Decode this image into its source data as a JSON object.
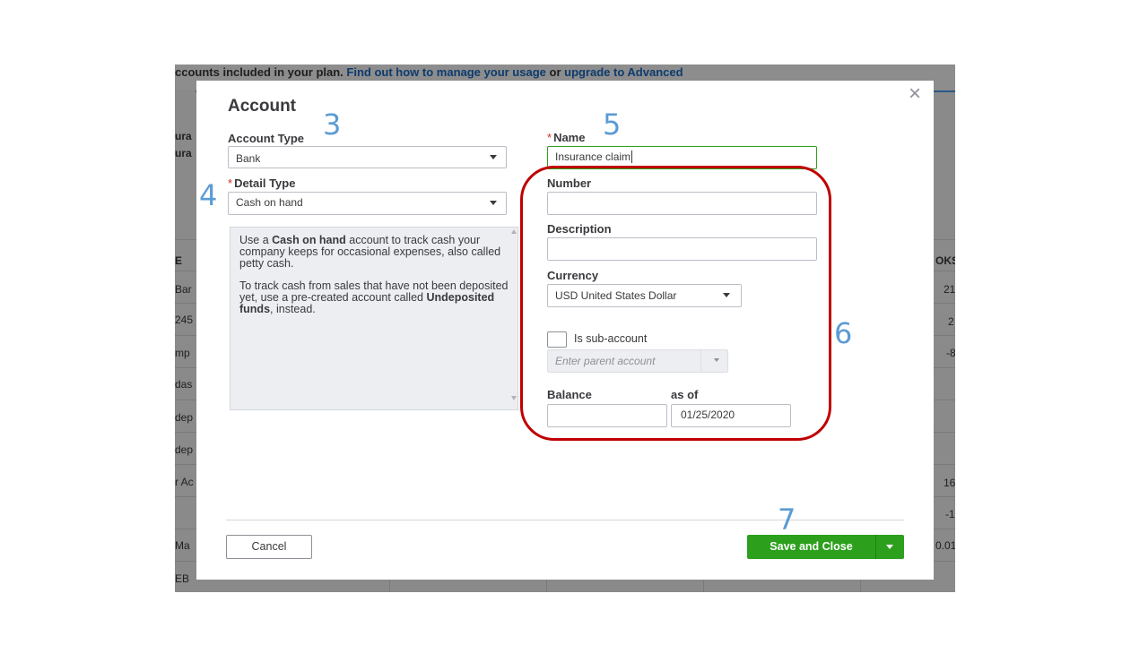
{
  "background": {
    "banner_text": "ccounts included in your plan. ",
    "banner_link_manage": "Find out how to manage your usage",
    "banner_or": " or ",
    "banner_link_upgrade": "upgrade to Advanced",
    "side_texts": [
      "ura",
      "ura",
      "E",
      "Bar",
      "245",
      "mp",
      "das",
      "dep",
      "dep",
      "r Ac",
      "Ma",
      "EB"
    ],
    "right_texts": [
      "OKS",
      "21",
      "2",
      "-8",
      "16",
      "-1",
      "0.01"
    ]
  },
  "modal": {
    "title": "Account",
    "close_label": "×",
    "account_type": {
      "label": "Account Type",
      "value": "Bank"
    },
    "detail_type": {
      "label": "Detail Type",
      "required_mark": "*",
      "value": "Cash on hand"
    },
    "description_panel": {
      "p1_pre": "Use a ",
      "p1_bold": "Cash on hand",
      "p1_post": " account to track cash your company keeps for occasional expenses, also called petty cash.",
      "p2_pre": "To track cash from sales that have not been deposited yet, use a pre-created account called ",
      "p2_bold": "Undeposited funds",
      "p2_post": ", instead."
    },
    "name": {
      "label": "Name",
      "required_mark": "*",
      "value": "Insurance claim"
    },
    "number": {
      "label": "Number",
      "value": ""
    },
    "description": {
      "label": "Description",
      "value": ""
    },
    "currency": {
      "label": "Currency",
      "value": "USD United States Dollar"
    },
    "sub_account": {
      "label": "Is sub-account",
      "checked": false
    },
    "parent_account": {
      "placeholder": "Enter parent account"
    },
    "balance": {
      "label": "Balance",
      "value": ""
    },
    "as_of": {
      "label": "as of",
      "value": "01/25/2020"
    },
    "cancel_label": "Cancel",
    "save_label": "Save and Close"
  },
  "annotations": [
    "3",
    "4",
    "5",
    "6",
    "7"
  ],
  "colors": {
    "accent_green": "#2ca01c",
    "required_red": "#d52b1e",
    "annotation_blue": "#5b9bd5",
    "annotation_ring": "#c00000"
  }
}
